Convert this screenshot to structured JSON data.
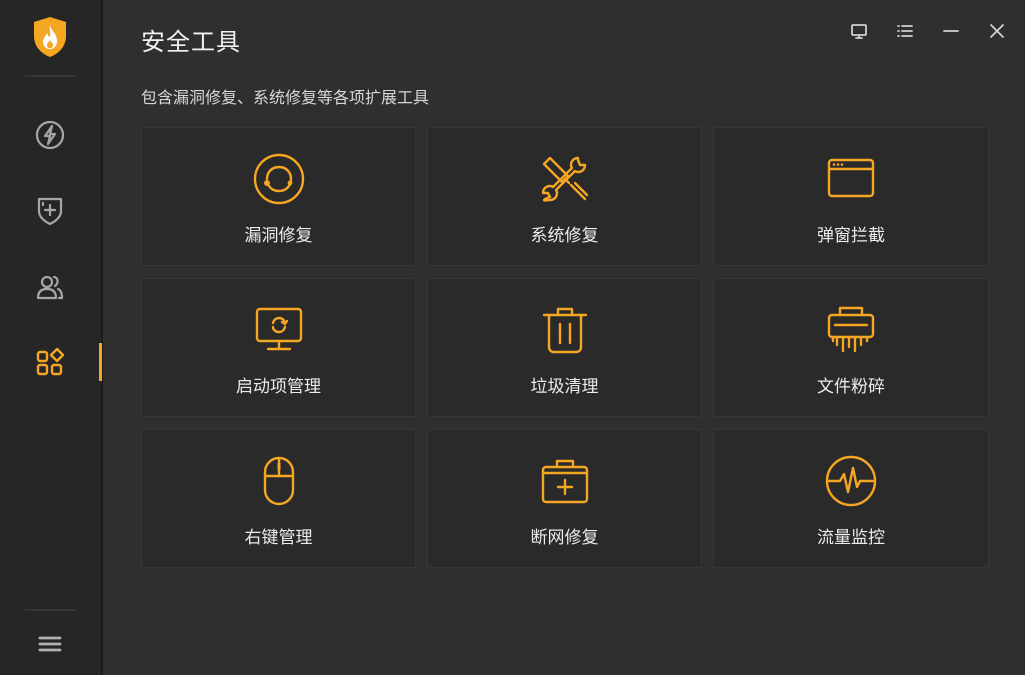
{
  "page": {
    "title": "安全工具",
    "subtitle": "包含漏洞修复、系统修复等各项扩展工具"
  },
  "colors": {
    "accent": "#f5a623",
    "sidebar_bg": "#262626",
    "main_bg": "#2f2f2f",
    "card_bg": "#2a2a2a"
  },
  "sidebar": {
    "logo_icon": "flame-shield-icon",
    "items": [
      {
        "icon": "lightning-icon",
        "active": false
      },
      {
        "icon": "shield-plus-icon",
        "active": false
      },
      {
        "icon": "users-icon",
        "active": false
      },
      {
        "icon": "apps-icon",
        "active": true
      }
    ],
    "menu_icon": "hamburger-menu-icon"
  },
  "window_controls": [
    "feedback-icon",
    "menu-list-icon",
    "minimize-icon",
    "close-icon"
  ],
  "tools": [
    {
      "label": "漏洞修复",
      "icon": "vulnerability-repair-icon"
    },
    {
      "label": "系统修复",
      "icon": "wrench-screwdriver-icon"
    },
    {
      "label": "弹窗拦截",
      "icon": "popup-window-icon"
    },
    {
      "label": "启动项管理",
      "icon": "monitor-refresh-icon"
    },
    {
      "label": "垃圾清理",
      "icon": "trash-icon"
    },
    {
      "label": "文件粉碎",
      "icon": "shredder-icon"
    },
    {
      "label": "右键管理",
      "icon": "mouse-icon"
    },
    {
      "label": "断网修复",
      "icon": "medkit-icon"
    },
    {
      "label": "流量监控",
      "icon": "pulse-monitor-icon"
    }
  ]
}
